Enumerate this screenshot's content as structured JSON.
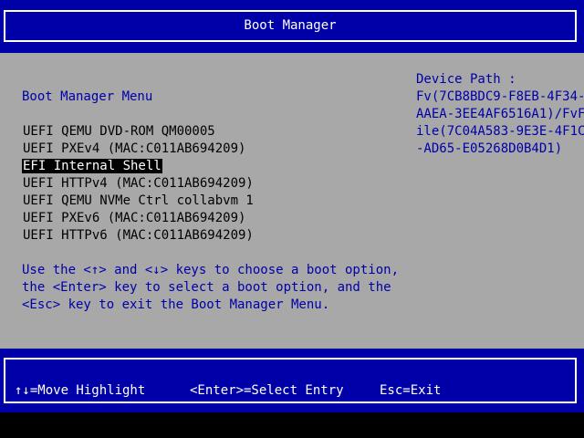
{
  "header": {
    "title": "Boot Manager"
  },
  "menu": {
    "title": "Boot Manager Menu",
    "items": [
      "UEFI QEMU DVD-ROM QM00005",
      "UEFI PXEv4 (MAC:C011AB694209)",
      "EFI Internal Shell",
      "UEFI HTTPv4 (MAC:C011AB694209)",
      "UEFI QEMU NVMe Ctrl collabvm 1",
      "UEFI PXEv6 (MAC:C011AB694209)",
      "UEFI HTTPv6 (MAC:C011AB694209)"
    ],
    "selected_index": 2
  },
  "help": {
    "lines": [
      "Use the <↑> and <↓> keys to choose a boot option,",
      "the <Enter> key to select a boot option, and the",
      "<Esc> key to exit the Boot Manager Menu."
    ]
  },
  "device_path": {
    "lines": [
      "Device Path :",
      "Fv(7CB8BDC9-F8EB-4F34-",
      "AAEA-3EE4AF6516A1)/FvF",
      "ile(7C04A583-9E3E-4F1C",
      "-AD65-E05268D0B4D1)"
    ]
  },
  "footer": {
    "move": "↑↓=Move Highlight",
    "select": "<Enter>=Select Entry",
    "exit": "Esc=Exit"
  },
  "colors": {
    "blue": "#0000a8",
    "gray": "#a8a8a8",
    "white": "#ffffff",
    "black": "#000000"
  }
}
